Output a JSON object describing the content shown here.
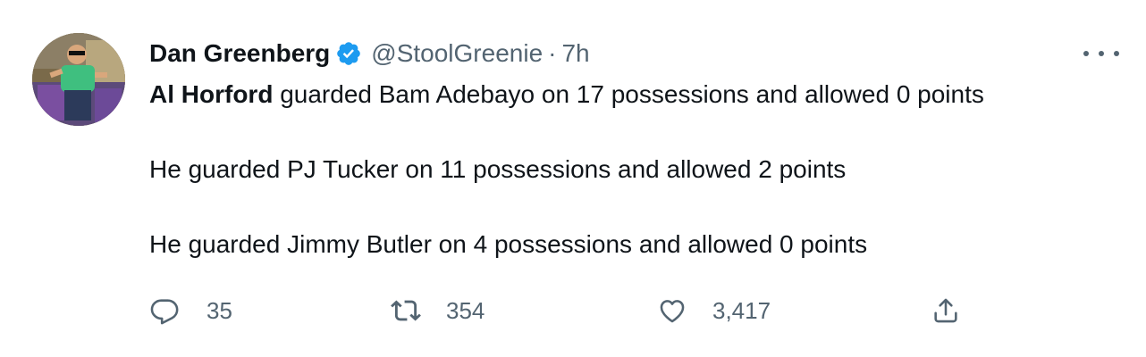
{
  "author": {
    "name": "Dan Greenberg",
    "handle": "@StoolGreenie",
    "separator": "·",
    "time": "7h",
    "verified_icon": "verified-badge-icon",
    "verified_color": "#1d9bf0"
  },
  "tweet": {
    "line1_mention": "Al Horford",
    "line1_rest": " guarded Bam Adebayo on 17 possessions and allowed 0 points",
    "line2": "He guarded PJ Tucker on 11 possessions and allowed 2 points",
    "line3": "He guarded Jimmy Butler on 4 possessions and allowed 0 points"
  },
  "actions": {
    "reply": {
      "icon": "reply-icon",
      "count": "35"
    },
    "retweet": {
      "icon": "retweet-icon",
      "count": "354"
    },
    "like": {
      "icon": "heart-icon",
      "count": "3,417"
    },
    "share": {
      "icon": "share-icon"
    }
  },
  "menu": {
    "icon": "more-options-icon"
  },
  "colors": {
    "text_primary": "#0f1419",
    "text_secondary": "#536471",
    "accent": "#1d9bf0",
    "background": "#ffffff"
  }
}
